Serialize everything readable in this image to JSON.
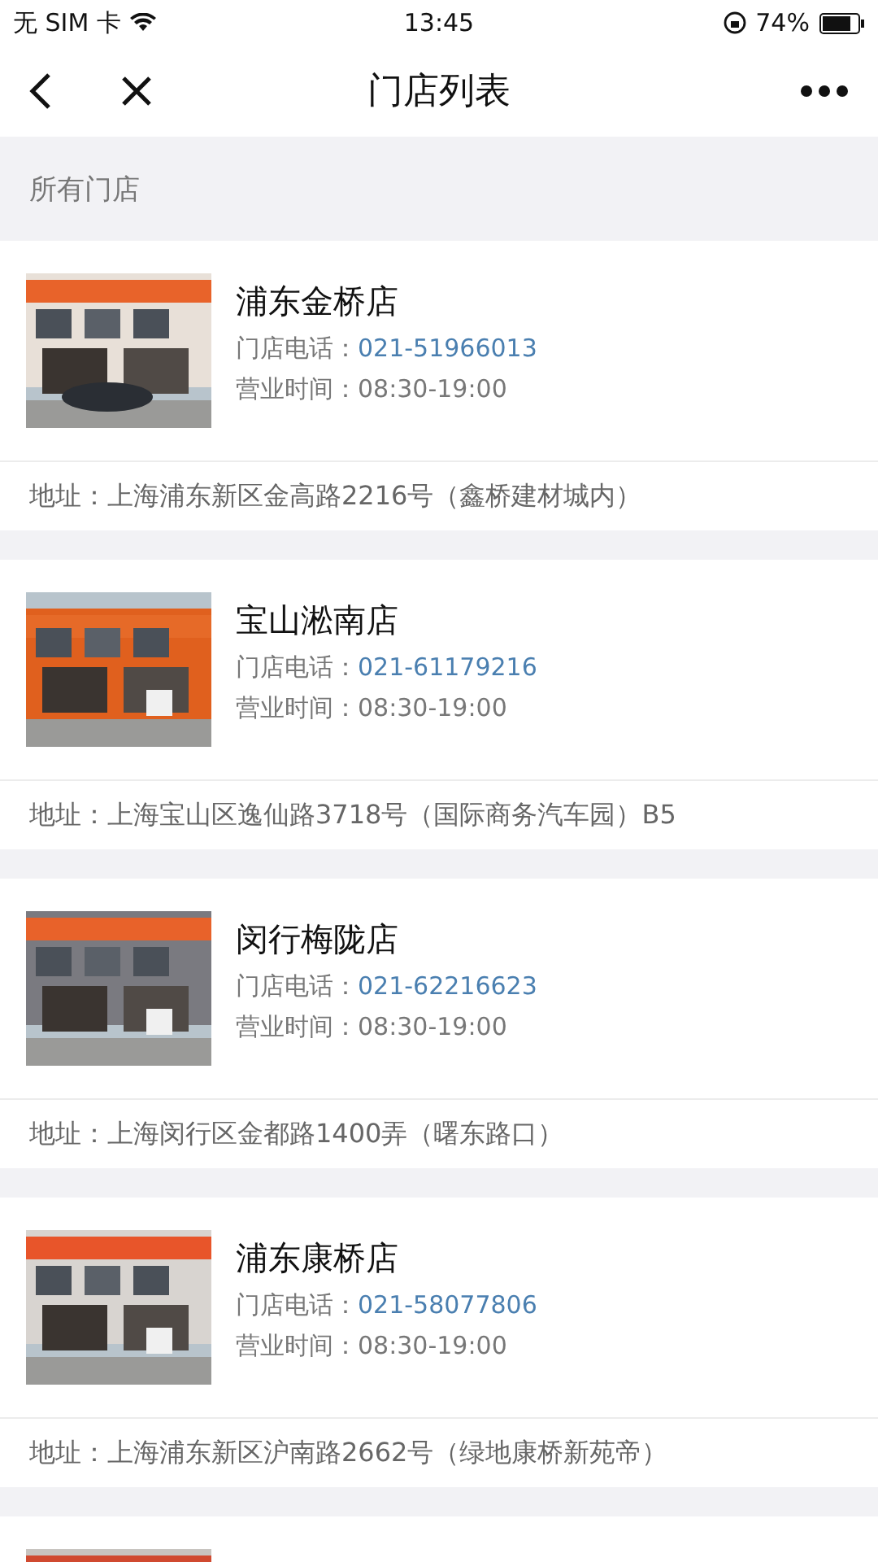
{
  "status_bar": {
    "carrier": "无 SIM 卡",
    "time": "13:45",
    "battery": "74%"
  },
  "nav": {
    "title": "门店列表"
  },
  "section": {
    "title": "所有门店"
  },
  "stores": [
    {
      "name": "浦东金桥店",
      "phone_label": "门店电话：",
      "phone": "021-51966013",
      "hours_label": "营业时间：",
      "hours": "08:30-19:00",
      "address": "地址：上海浦东新区金高路2216号（鑫桥建材城内）",
      "picture": {
        "kind": "picture"
      }
    },
    {
      "name": "宝山淞南店",
      "phone_label": "门店电话：",
      "phone": "021-61179216",
      "hours_label": "营业时间：",
      "hours": "08:30-19:00",
      "address": "地址：上海宝山区逸仙路3718号（国际商务汽车园）B5",
      "picture": {
        "kind": "picture"
      }
    },
    {
      "name": "闵行梅陇店",
      "phone_label": "门店电话：",
      "phone": "021-62216623",
      "hours_label": "营业时间：",
      "hours": "08:30-19:00",
      "address": "地址：上海闵行区金都路1400弄（曙东路口）",
      "picture": {
        "kind": "picture"
      }
    },
    {
      "name": "浦东康桥店",
      "phone_label": "门店电话：",
      "phone": "021-58077806",
      "hours_label": "营业时间：",
      "hours": "08:30-19:00",
      "address": "地址：上海浦东新区沪南路2662号（绿地康桥新苑帝）",
      "picture": {
        "kind": "picture"
      }
    },
    {
      "picture": {
        "kind": "picture"
      }
    }
  ]
}
